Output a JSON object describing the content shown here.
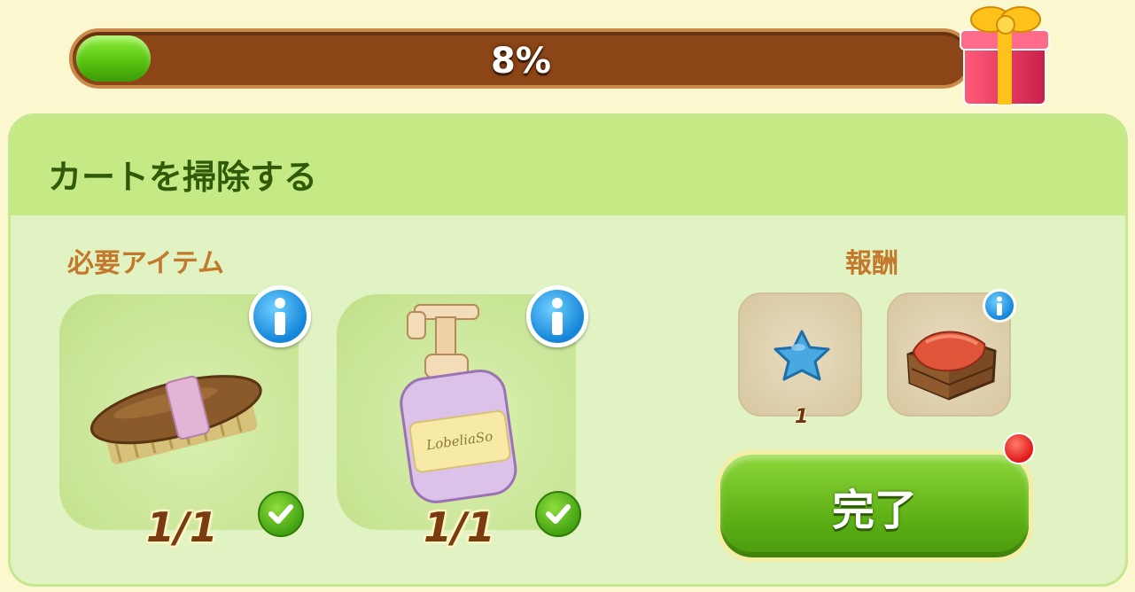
{
  "progress": {
    "percent": 8,
    "label": "8%"
  },
  "task": {
    "title": "カートを掃除する"
  },
  "required": {
    "label": "必要アイテム",
    "items": [
      {
        "name": "brush",
        "icon": "brush-icon",
        "count": "1/1",
        "complete": true
      },
      {
        "name": "soap",
        "icon": "soap-bottle-icon",
        "count": "1/1",
        "complete": true
      }
    ]
  },
  "rewards": {
    "label": "報酬",
    "items": [
      {
        "name": "blue-star",
        "icon": "blue-star-icon",
        "qty": "1"
      },
      {
        "name": "crate",
        "icon": "crate-with-cloth-icon",
        "qty": ""
      }
    ]
  },
  "button": {
    "complete_label": "完了"
  },
  "colors": {
    "accent_green": "#5fb217",
    "progress_track": "#8b4516",
    "label_orange": "#c4782c",
    "title_green": "#2f5b08"
  }
}
